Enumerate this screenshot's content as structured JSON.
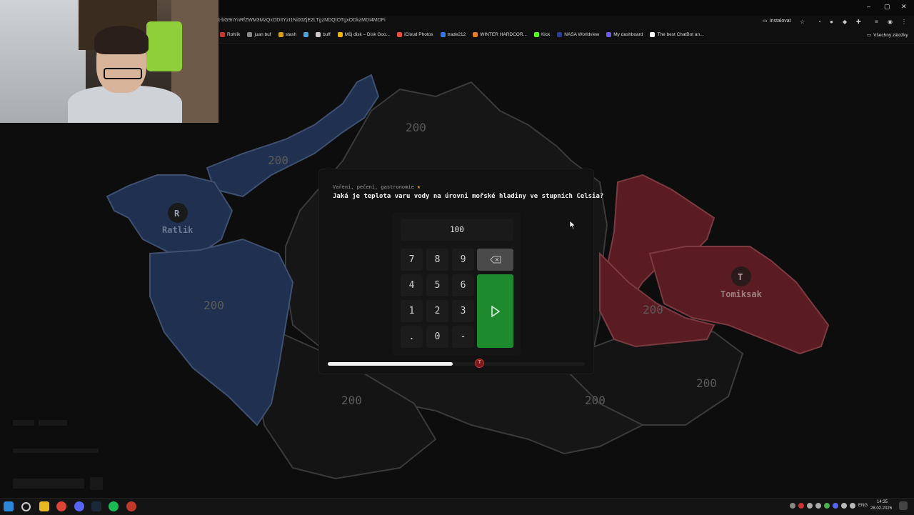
{
  "browser": {
    "url": "t-bG9nYnRfZWM3MzQxODItYzI1Ni00ZjE2LTgzNDQtOTgxODkzMDI4MDFi",
    "install_label": "Instalovat",
    "bookmarks": [
      {
        "label": "Rohlík",
        "color": "#c0392b"
      },
      {
        "label": "juan buf",
        "color": "#888888"
      },
      {
        "label": "stash",
        "color": "#d4a017"
      },
      {
        "label": "",
        "color": "#4aa3df"
      },
      {
        "label": "buff",
        "color": "#cccccc"
      },
      {
        "label": "Můj disk – Disk Goo...",
        "color": "#f4b400"
      },
      {
        "label": "iCloud Photos",
        "color": "#e74c3c"
      },
      {
        "label": "trade212",
        "color": "#2c7be5"
      },
      {
        "label": "WINTER HARDCOR...",
        "color": "#e67e22"
      },
      {
        "label": "Kick",
        "color": "#53fc18"
      },
      {
        "label": "NASA Worldview",
        "color": "#2c3e8f"
      },
      {
        "label": "My dashboard",
        "color": "#6c5ce7"
      },
      {
        "label": "The best ChatBot an...",
        "color": "#ffffff"
      }
    ],
    "all_bookmarks_label": "Všechny záložky",
    "window_controls": [
      "–",
      "▢",
      "✕"
    ]
  },
  "map": {
    "region_values": [
      "200",
      "200",
      "200",
      "200",
      "200",
      "200",
      "200",
      "200"
    ],
    "players": [
      {
        "initial": "R",
        "name": "Ratlik",
        "color": "#1f3050"
      },
      {
        "initial": "T",
        "name": "Tomiksak",
        "color": "#5a1c22"
      }
    ]
  },
  "question": {
    "category": "Vaření, pečení, gastronomie",
    "star": "★",
    "text": "Jaká je teplota varu vody na úrovni mořské hladiny ve stupních Celsia?"
  },
  "keypad": {
    "display_value": "100",
    "keys": [
      "7",
      "8",
      "9",
      "4",
      "5",
      "6",
      "1",
      "2",
      "3",
      ".",
      "0",
      "-"
    ]
  },
  "timer": {
    "progress": 0.485,
    "marker_fraction": 0.59,
    "marker_initial": "T"
  },
  "taskbar": {
    "lang": "ENG",
    "time": "14:35",
    "date": "28.02.2026"
  },
  "colors": {
    "blue_region": "#1f3050",
    "red_region": "#5a1c22",
    "neutral_region": "#161616",
    "submit": "#1e8a2e"
  }
}
